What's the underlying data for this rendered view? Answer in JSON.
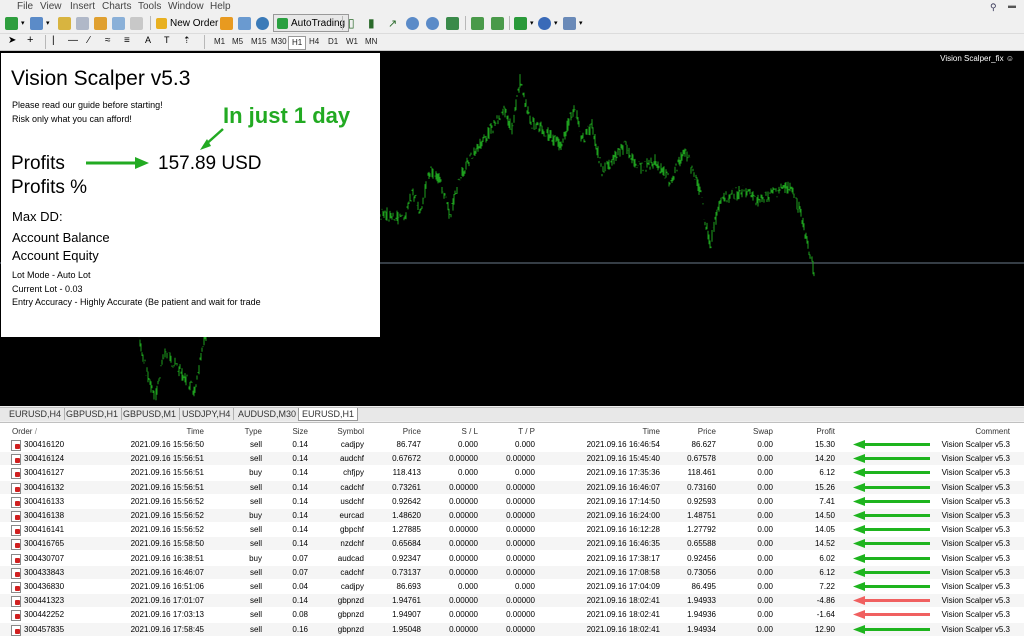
{
  "menu": [
    "File",
    "View",
    "Insert",
    "Charts",
    "Tools",
    "Window",
    "Help"
  ],
  "toolbar": {
    "new_order": "New Order",
    "auto_trading": "AutoTrading"
  },
  "timeframes": [
    "M1",
    "M5",
    "M15",
    "M30",
    "H1",
    "H4",
    "D1",
    "W1",
    "MN"
  ],
  "active_timeframe": "H1",
  "chart": {
    "indicator_label": "Vision Scalper_fix",
    "line_color": "#1ea01e"
  },
  "panel": {
    "title": "Vision Scalper v5.3",
    "guide": "Please read our guide before starting!",
    "risk": "Risk only what you can afford!",
    "callout": "In just 1 day",
    "profits_label": "Profits",
    "profits_value": "157.89 USD",
    "profits_pct_label": "Profits %",
    "max_dd_label": "Max DD:",
    "balance_label": "Account Balance",
    "equity_label": "Account Equity",
    "lot_mode": "Lot Mode - Auto Lot",
    "current_lot": "Current Lot - 0.03",
    "entry_accuracy": "Entry Accuracy - Highly Accurate (Be patient and wait for trade"
  },
  "chart_tabs": [
    "EURUSD,H4",
    "GBPUSD,H1",
    "GBPUSD,M1",
    "USDJPY,H4",
    "AUDUSD,M30",
    "EURUSD,H1"
  ],
  "active_tab": 5,
  "columns": [
    "Order",
    "Time",
    "Type",
    "Size",
    "Symbol",
    "Price",
    "S / L",
    "T / P",
    "Time",
    "Price",
    "Swap",
    "Profit",
    "Comment"
  ],
  "order_sort_mark": "/",
  "rows": [
    [
      "300416120",
      "2021.09.16 15:56:50",
      "sell",
      "0.14",
      "cadjpy",
      "86.747",
      "0.000",
      "0.000",
      "2021.09.16 16:46:54",
      "86.627",
      "0.00",
      "15.30",
      "Vision Scalper v5.3"
    ],
    [
      "300416124",
      "2021.09.16 15:56:51",
      "sell",
      "0.14",
      "audchf",
      "0.67672",
      "0.00000",
      "0.00000",
      "2021.09.16 15:45:40",
      "0.67578",
      "0.00",
      "14.20",
      "Vision Scalper v5.3"
    ],
    [
      "300416127",
      "2021.09.16 15:56:51",
      "buy",
      "0.14",
      "chfjpy",
      "118.413",
      "0.000",
      "0.000",
      "2021.09.16 17:35:36",
      "118.461",
      "0.00",
      "6.12",
      "Vision Scalper v5.3"
    ],
    [
      "300416132",
      "2021.09.16 15:56:51",
      "sell",
      "0.14",
      "cadchf",
      "0.73261",
      "0.00000",
      "0.00000",
      "2021.09.16 16:46:07",
      "0.73160",
      "0.00",
      "15.26",
      "Vision Scalper v5.3"
    ],
    [
      "300416133",
      "2021.09.16 15:56:52",
      "sell",
      "0.14",
      "usdchf",
      "0.92642",
      "0.00000",
      "0.00000",
      "2021.09.16 17:14:50",
      "0.92593",
      "0.00",
      "7.41",
      "Vision Scalper v5.3"
    ],
    [
      "300416138",
      "2021.09.16 15:56:52",
      "buy",
      "0.14",
      "eurcad",
      "1.48620",
      "0.00000",
      "0.00000",
      "2021.09.16 16:24:00",
      "1.48751",
      "0.00",
      "14.50",
      "Vision Scalper v5.3"
    ],
    [
      "300416141",
      "2021.09.16 15:56:52",
      "sell",
      "0.14",
      "gbpchf",
      "1.27885",
      "0.00000",
      "0.00000",
      "2021.09.16 16:12:28",
      "1.27792",
      "0.00",
      "14.05",
      "Vision Scalper v5.3"
    ],
    [
      "300416765",
      "2021.09.16 15:58:50",
      "sell",
      "0.14",
      "nzdchf",
      "0.65684",
      "0.00000",
      "0.00000",
      "2021.09.16 16:46:35",
      "0.65588",
      "0.00",
      "14.52",
      "Vision Scalper v5.3"
    ],
    [
      "300430707",
      "2021.09.16 16:38:51",
      "buy",
      "0.07",
      "audcad",
      "0.92347",
      "0.00000",
      "0.00000",
      "2021.09.16 17:38:17",
      "0.92456",
      "0.00",
      "6.02",
      "Vision Scalper v5.3"
    ],
    [
      "300433843",
      "2021.09.16 16:46:07",
      "sell",
      "0.07",
      "cadchf",
      "0.73137",
      "0.00000",
      "0.00000",
      "2021.09.16 17:08:58",
      "0.73056",
      "0.00",
      "6.12",
      "Vision Scalper v5.3"
    ],
    [
      "300436830",
      "2021.09.16 16:51:06",
      "sell",
      "0.04",
      "cadjpy",
      "86.693",
      "0.000",
      "0.000",
      "2021.09.16 17:04:09",
      "86.495",
      "0.00",
      "7.22",
      "Vision Scalper v5.3"
    ],
    [
      "300441323",
      "2021.09.16 17:01:07",
      "sell",
      "0.14",
      "gbpnzd",
      "1.94761",
      "0.00000",
      "0.00000",
      "2021.09.16 18:02:41",
      "1.94933",
      "0.00",
      "-4.86",
      "Vision Scalper v5.3"
    ],
    [
      "300442252",
      "2021.09.16 17:03:13",
      "sell",
      "0.08",
      "gbpnzd",
      "1.94907",
      "0.00000",
      "0.00000",
      "2021.09.16 18:02:41",
      "1.94936",
      "0.00",
      "-1.64",
      "Vision Scalper v5.3"
    ],
    [
      "300457835",
      "2021.09.16 17:58:45",
      "sell",
      "0.16",
      "gbpnzd",
      "1.95048",
      "0.00000",
      "0.00000",
      "2021.09.16 18:02:41",
      "1.94934",
      "0.00",
      "12.90",
      "Vision Scalper v5.3"
    ]
  ],
  "colors": {
    "win_arrow": "#1eb41e",
    "loss_arrow": "#f06060",
    "callout": "#22aa22"
  }
}
